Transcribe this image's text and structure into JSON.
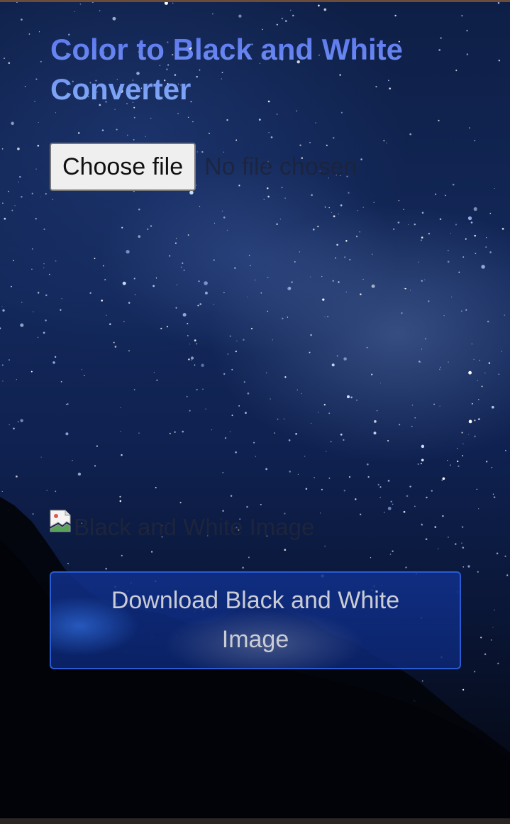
{
  "page": {
    "title": "Color to Black and White Converter"
  },
  "file_input": {
    "button_label": "Choose file",
    "status_text": "No file chosen"
  },
  "result_image": {
    "alt_text": "Black and White Image",
    "icon": "broken-image-icon"
  },
  "download": {
    "label": "Download Black and White Image"
  },
  "colors": {
    "title": "#5d7df0",
    "download_border": "#2a5bd2",
    "download_bg": "#10308c"
  }
}
